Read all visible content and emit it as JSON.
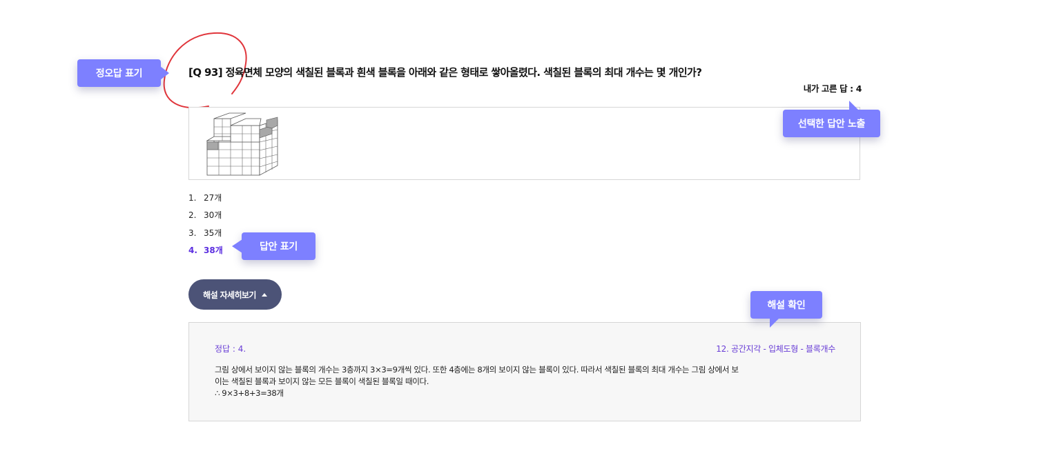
{
  "question": {
    "title": "[Q 93] 정육면체 모양의 색칠된 블록과 흰색 블록을 아래와 같은 형태로 쌓아올렸다. 색칠된 블록의 최대 개수는 몇 개인가?",
    "my_answer": "내가 고른 답 : 4"
  },
  "options": [
    {
      "num": "1.",
      "text": "27개"
    },
    {
      "num": "2.",
      "text": "30개"
    },
    {
      "num": "3.",
      "text": "35개"
    },
    {
      "num": "4.",
      "text": "38개"
    }
  ],
  "selected_option": 4,
  "toggle": {
    "label": "해설 자세히보기",
    "icon": "caret-up-icon"
  },
  "explanation": {
    "correct": "정답 : 4.",
    "category": "12. 공간지각 - 입체도형 - 블록개수",
    "line1": "그림 상에서 보이지 않는 블록의 개수는 3층까지 3×3=9개씩 있다. 또한 4층에는 8개의 보이지 않는 블록이 있다. 따라서 색칠된 블록의 최대 개수는 그림 상에서 보",
    "line2": "이는 색칠된 블록과 보이지 않는 모든 블록이 색칠된 블록일 때이다.",
    "line3": "∴ 9×3+8+3=38개"
  },
  "annotations": {
    "correctness": "정오답 표기",
    "selected_answer": "선택한 답안 노출",
    "answer_mark": "답안 표기",
    "check_explanation": "해설 확인"
  },
  "colors": {
    "tag": "#7d80ff",
    "selected": "#5b2ee0",
    "toggle_bg": "#4c5377",
    "accent_text": "#6a3fd6",
    "circle": "#e0353b"
  }
}
